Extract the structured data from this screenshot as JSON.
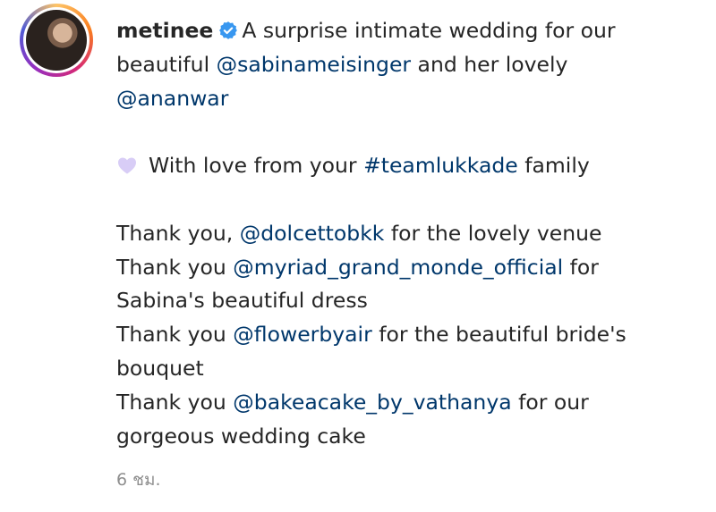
{
  "post": {
    "username": "metinee",
    "verified": true,
    "caption_line1": "A surprise intimate wedding for our",
    "caption_line2_start": "beautiful",
    "mention1": "@sabinameisinger",
    "caption_line2_end": "and her lovely",
    "mention2": "@ananwar",
    "love_text_start": "With love from your",
    "hashtag": "#teamlukkade",
    "love_text_end": "family",
    "thanks1_start": "Thank you,",
    "mention3": "@dolcettobkk",
    "thanks1_end": "for the lovely venue",
    "thanks2_start": "Thank you",
    "mention4": "@myriad_grand_monde_official",
    "thanks2_end": "for",
    "thanks2_cont": "Sabina's beautiful dress",
    "thanks3_start": "Thank you",
    "mention5": "@flowerbyair",
    "thanks3_end": "for the beautiful bride's",
    "thanks3_cont": "bouquet",
    "thanks4_start": "Thank you",
    "mention6": "@bakeacake_by_vathanya",
    "thanks4_end": "for our",
    "thanks4_cont": "gorgeous wedding cake",
    "timestamp": "6 ชม.",
    "heart_icon": "light-purple-heart-icon",
    "accent": "#00376b",
    "verified_color": "#3897f0"
  }
}
